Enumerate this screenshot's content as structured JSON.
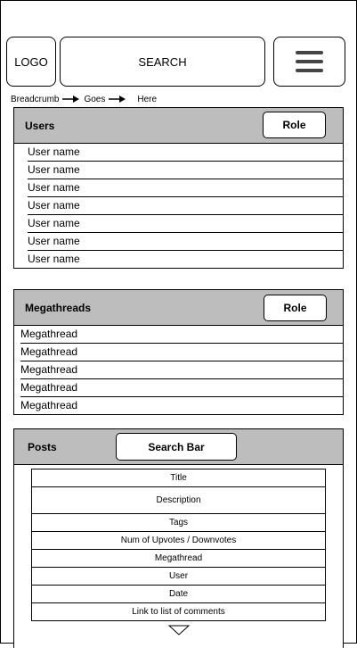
{
  "topbar": {
    "logo": "LOGO",
    "search": "SEARCH",
    "menu_icon": "hamburger-menu-icon"
  },
  "breadcrumb": [
    "Breadcrumb",
    "Goes",
    "Here"
  ],
  "users": {
    "title": "Users",
    "role_label": "Role",
    "rows": [
      "User name",
      "User name",
      "User name",
      "User name",
      "User name",
      "User name",
      "User name"
    ]
  },
  "megathreads": {
    "title": "Megathreads",
    "role_label": "Role",
    "rows": [
      "Megathread",
      "Megathread",
      "Megathread",
      "Megathread",
      "Megathread"
    ]
  },
  "posts": {
    "title": "Posts",
    "search_label": "Search Bar",
    "fields": [
      "Title",
      "Description",
      "Tags",
      "Num of Upvotes / Downvotes",
      "Megathread",
      "User",
      "Date",
      "Link to list of comments"
    ]
  }
}
